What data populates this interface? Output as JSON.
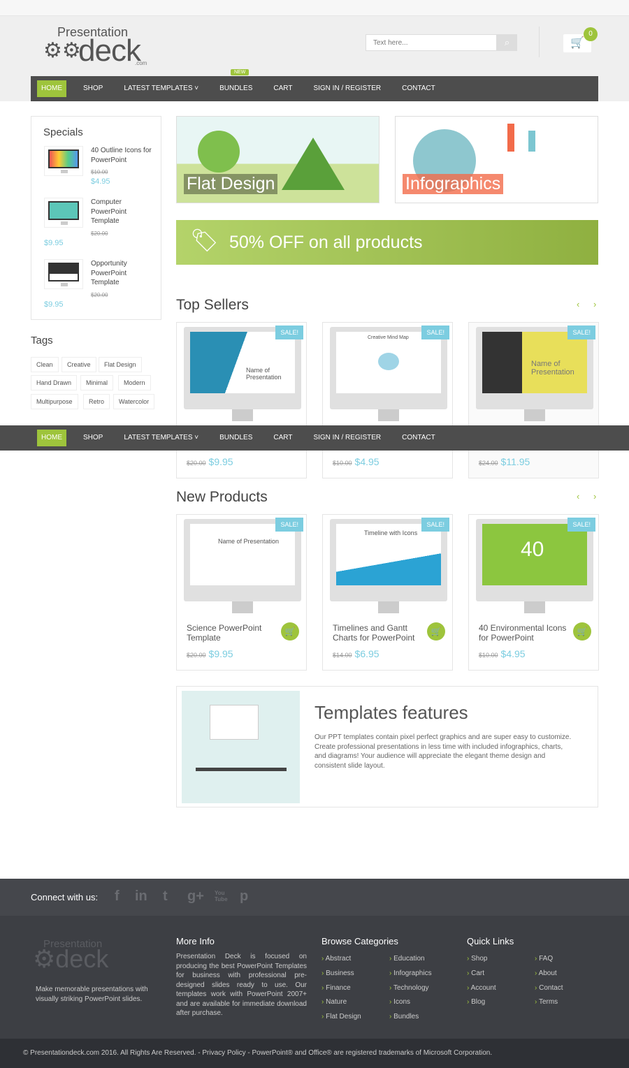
{
  "header": {
    "logo_top": "Presentation",
    "logo_main": "deck",
    "logo_sub": ".com",
    "search_placeholder": "Text here...",
    "cart_count": "0",
    "search_icon": "search-icon",
    "cart_icon": "cart-icon"
  },
  "nav": {
    "items": [
      "HOME",
      "SHOP",
      "LATEST TEMPLATES ˅",
      "BUNDLES",
      "CART",
      "SIGN IN / REGISTER",
      "CONTACT"
    ],
    "new_badge": "NEW"
  },
  "specials": {
    "title": "Specials",
    "items": [
      {
        "title": "40 Outline Icons for PowerPoint",
        "old": "$10.00",
        "price": "$4.95"
      },
      {
        "title": "Computer PowerPoint Template",
        "old": "$20.00",
        "price": "$9.95"
      },
      {
        "title": "Opportunity PowerPoint Template",
        "old": "$20.00",
        "price": "$9.95"
      }
    ]
  },
  "tags": {
    "title": "Tags",
    "items": [
      "Clean",
      "Creative",
      "Flat Design",
      "Hand Drawn",
      "Minimal",
      "Modern",
      "Multipurpose",
      "Retro",
      "Watercolor"
    ]
  },
  "banners": {
    "flat": "Flat Design",
    "info": "Infographics",
    "promo": "50% OFF on all products"
  },
  "top_sellers": {
    "title": "Top Sellers",
    "prev": "‹",
    "next": "›",
    "items": [
      {
        "sale": "SALE!",
        "screen": "Name of Presentation",
        "old": "$20.00",
        "price": "$9.95"
      },
      {
        "sale": "SALE!",
        "screen": "Creative Mind Map",
        "old": "$10.00",
        "price": "$4.95"
      },
      {
        "sale": "SALE!",
        "screen": "Name of Presentation",
        "old": "$24.00",
        "price": "$11.95"
      }
    ]
  },
  "new_products": {
    "title": "New Products",
    "prev": "‹",
    "next": "›",
    "items": [
      {
        "sale": "SALE!",
        "screen": "Name of Presentation",
        "title": "Science PowerPoint Template",
        "old": "$20.00",
        "price": "$9.95"
      },
      {
        "sale": "SALE!",
        "screen": "Timeline with Icons",
        "title": "Timelines and Gantt Charts for PowerPoint",
        "old": "$14.00",
        "price": "$6.95"
      },
      {
        "sale": "SALE!",
        "screen": "40",
        "title": "40 Environmental Icons for PowerPoint",
        "old": "$10.00",
        "price": "$4.95"
      }
    ]
  },
  "features": {
    "title": "Templates features",
    "text": "Our PPT templates contain pixel perfect graphics and are super easy to customize. Create professional presentations in less time with included infographics, charts, and diagrams! Your audience will appreciate the elegant theme design and consistent slide layout."
  },
  "footer": {
    "connect": "Connect with us:",
    "social": [
      "f",
      "in",
      "t",
      "g+",
      "You Tube",
      "p"
    ],
    "tagline": "Make memorable presentations with visually striking PowerPoint slides.",
    "more_info_title": "More Info",
    "more_info": "Presentation Deck is focused on producing the best PowerPoint Templates for business with professional pre-designed slides ready to use. Our templates work with PowerPoint 2007+ and are available for immediate download after purchase.",
    "browse_title": "Browse Categories",
    "browse": [
      "Abstract",
      "Business",
      "Finance",
      "Nature",
      "Flat Design",
      "Education",
      "Infographics",
      "Technology",
      "Icons",
      "Bundles"
    ],
    "quick_title": "Quick Links",
    "quick": [
      "Shop",
      "Cart",
      "Account",
      "Blog",
      "FAQ",
      "About",
      "Contact",
      "Terms"
    ],
    "copyright": "© Presentationdeck.com 2016. All Rights Are Reserved. - Privacy Policy - PowerPoint® and Office® are registered trademarks of Microsoft Corporation."
  }
}
